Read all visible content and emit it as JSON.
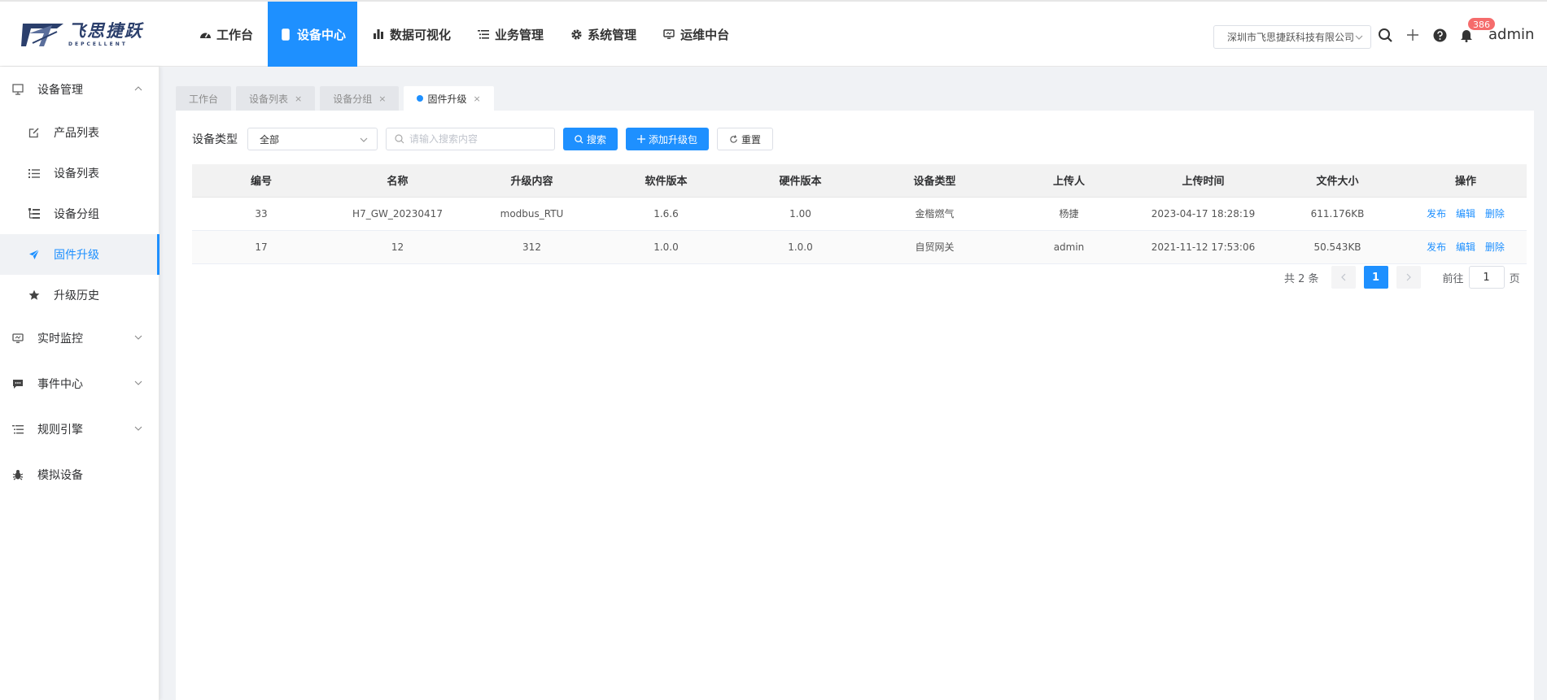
{
  "app": {
    "logo_cn": "飞思捷跃",
    "logo_en": "DEPCELLENT",
    "user": "admin",
    "notification_count": "386",
    "company": "深圳市飞思捷跃科技有限公司",
    "accent": "#1e90ff"
  },
  "nav": {
    "items": [
      {
        "label": "工作台",
        "icon": "dashboard-icon"
      },
      {
        "label": "设备中心",
        "icon": "mobile-icon"
      },
      {
        "label": "数据可视化",
        "icon": "bar-chart-icon"
      },
      {
        "label": "业务管理",
        "icon": "list-icon"
      },
      {
        "label": "系统管理",
        "icon": "gear-icon"
      },
      {
        "label": "运维中台",
        "icon": "monitor-icon"
      }
    ]
  },
  "sidebar": {
    "device_mgmt": "设备管理",
    "product_list": "产品列表",
    "device_list": "设备列表",
    "device_group": "设备分组",
    "firmware_upgrade": "固件升级",
    "upgrade_history": "升级历史",
    "realtime_monitor": "实时监控",
    "event_center": "事件中心",
    "rule_engine": "规则引擎",
    "simulate_device": "模拟设备"
  },
  "tabs": [
    {
      "label": "工作台"
    },
    {
      "label": "设备列表"
    },
    {
      "label": "设备分组"
    },
    {
      "label": "固件升级"
    }
  ],
  "filter": {
    "label": "设备类型",
    "select_value": "全部",
    "search_placeholder": "请输入搜索内容",
    "search_btn": "搜索",
    "add_btn": "添加升级包",
    "reset_btn": "重置"
  },
  "table": {
    "headers": [
      "编号",
      "名称",
      "升级内容",
      "软件版本",
      "硬件版本",
      "设备类型",
      "上传人",
      "上传时间",
      "文件大小",
      "操作"
    ],
    "rows": [
      {
        "id": "33",
        "name": "H7_GW_20230417",
        "content": "modbus_RTU",
        "sw": "1.6.6",
        "hw": "1.00",
        "type": "金楷燃气",
        "uploader": "杨捷",
        "time": "2023-04-17 18:28:19",
        "size": "611.176KB"
      },
      {
        "id": "17",
        "name": "12",
        "content": "312",
        "sw": "1.0.0",
        "hw": "1.0.0",
        "type": "自贸网关",
        "uploader": "admin",
        "time": "2021-11-12 17:53:06",
        "size": "50.543KB"
      }
    ],
    "op_publish": "发布",
    "op_edit": "编辑",
    "op_delete": "删除"
  },
  "pager": {
    "total": "共 2 条",
    "current": "1",
    "goto_label": "前往",
    "goto_value": "1",
    "page_suffix": "页"
  }
}
